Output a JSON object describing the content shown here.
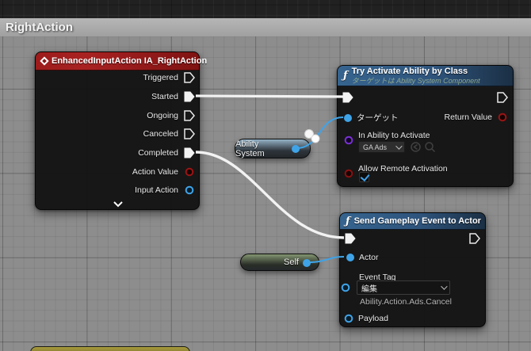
{
  "comment": {
    "title": "RightAction"
  },
  "nodes": {
    "event": {
      "title": "EnhancedInputAction IA_RightAction",
      "icon": "event-diamond-icon",
      "pins": [
        "Triggered",
        "Started",
        "Ongoing",
        "Canceled",
        "Completed",
        "Action Value",
        "Input Action"
      ],
      "collapse_icon": "chevron-down-icon"
    },
    "try_activate": {
      "title": "Try Activate Ability by Class",
      "subtitle": "ターゲットは Ability System Component",
      "icon": "function-f-icon",
      "target_label": "ターゲット",
      "return_label": "Return Value",
      "in_ability_label": "In Ability to Activate",
      "ability_class_value": "GA Ads",
      "allow_remote_label": "Allow Remote Activation",
      "allow_remote_checked": "true"
    },
    "send_event": {
      "title": "Send Gameplay Event to Actor",
      "icon": "function-f-icon",
      "actor_label": "Actor",
      "event_tag_label": "Event Tag",
      "event_tag_value": "編集",
      "event_tag_path": "Ability.Action.Ads.Cancel",
      "payload_label": "Payload"
    },
    "ability_system_var": {
      "label": "Ability System"
    },
    "self_var": {
      "label": "Self"
    }
  },
  "colors": {
    "event_header": "#9c1b1b",
    "function_header": "#36648f",
    "exec_wire": "#f2f2f2",
    "object_wire": "#3fa3e8",
    "object_pin": "#3fa3e8",
    "class_pin": "#7b2fd9",
    "struct_pin": "#9b1414",
    "graph_background": "#8d8d8d",
    "comment_bar": "#acacac"
  }
}
